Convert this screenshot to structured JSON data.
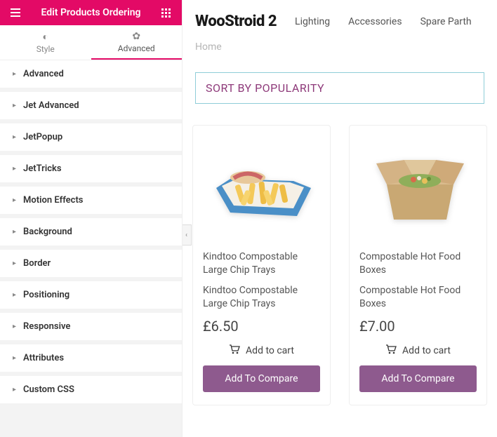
{
  "header": {
    "title": "Edit Products Ordering"
  },
  "tabs": [
    {
      "label": "Style",
      "icon": "◐"
    },
    {
      "label": "Advanced",
      "icon": "✿"
    }
  ],
  "accordion": [
    "Advanced",
    "Jet Advanced",
    "JetPopup",
    "JetTricks",
    "Motion Effects",
    "Background",
    "Border",
    "Positioning",
    "Responsive",
    "Attributes",
    "Custom CSS"
  ],
  "site": {
    "logo": "WooStroid 2",
    "nav": [
      "Lighting",
      "Accessories",
      "Spare Parth"
    ],
    "breadcrumb": "Home"
  },
  "sort": {
    "label": "SORT BY POPULARITY"
  },
  "products": [
    {
      "title": "Kindtoo Compostable Large Chip Trays",
      "sub": "Kindtoo Compostable Large Chip Trays",
      "price": "£6.50",
      "cart": "Add to cart",
      "compare": "Add To Compare"
    },
    {
      "title": "Compostable Hot Food Boxes",
      "sub": "Compostable Hot Food Boxes",
      "price": "£7.00",
      "cart": "Add to cart",
      "compare": "Add To Compare"
    }
  ]
}
